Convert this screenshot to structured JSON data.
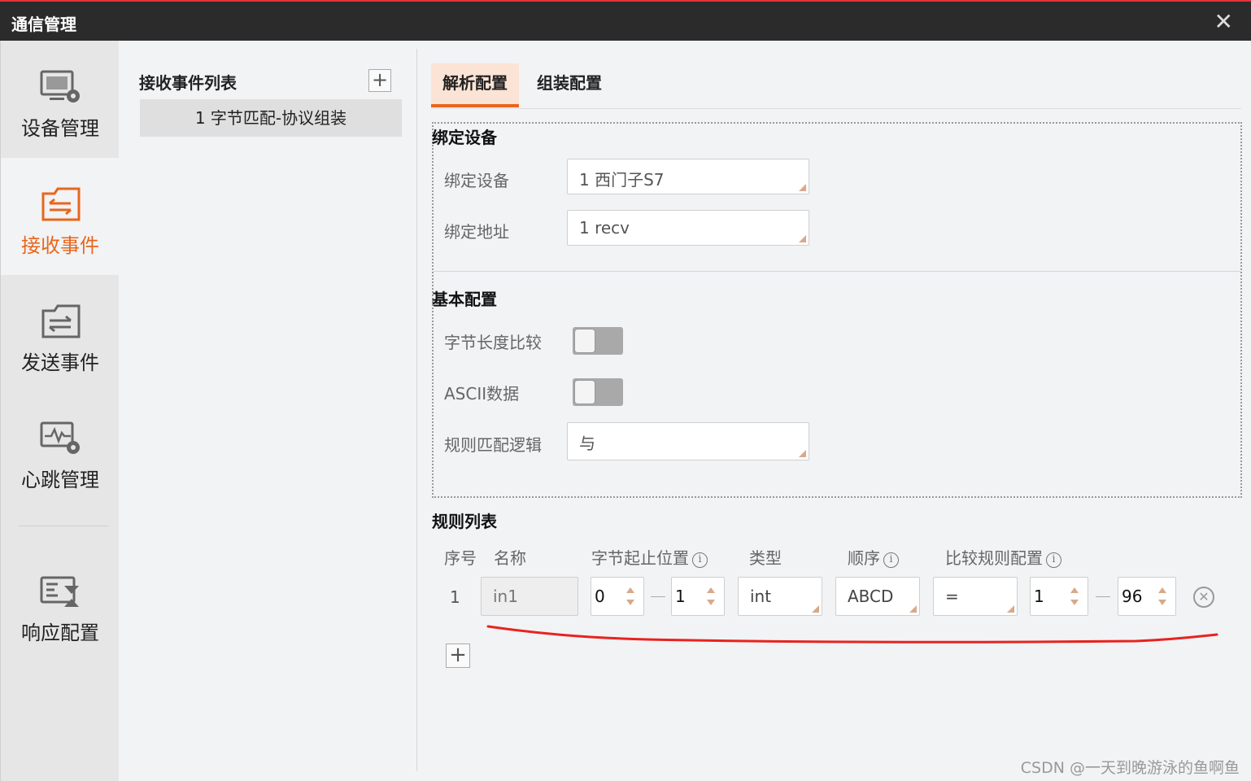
{
  "window": {
    "title": "通信管理",
    "close_glyph": "✕"
  },
  "nav": {
    "items": [
      {
        "label": "设备管理",
        "icon": "device-settings-icon"
      },
      {
        "label": "接收事件",
        "icon": "receive-event-icon",
        "active": true
      },
      {
        "label": "发送事件",
        "icon": "send-event-icon"
      },
      {
        "label": "心跳管理",
        "icon": "heartbeat-settings-icon"
      },
      {
        "label": "响应配置",
        "icon": "response-config-icon"
      }
    ],
    "accent_color": "#e8661c"
  },
  "events": {
    "title": "接收事件列表",
    "add_glyph": "+",
    "items": [
      {
        "label": "1 字节匹配-协议组装"
      }
    ]
  },
  "tabs": [
    {
      "label": "解析配置",
      "active": true
    },
    {
      "label": "组装配置"
    }
  ],
  "bind_section": {
    "title": "绑定设备",
    "device_label": "绑定设备",
    "device_value": "1 西门子S7",
    "address_label": "绑定地址",
    "address_value": "1 recv"
  },
  "basic_section": {
    "title": "基本配置",
    "byte_length_label": "字节长度比较",
    "byte_length_on": false,
    "ascii_label": "ASCII数据",
    "ascii_on": false,
    "logic_label": "规则匹配逻辑",
    "logic_value": "与"
  },
  "rules": {
    "title": "规则列表",
    "columns": {
      "index": "序号",
      "name": "名称",
      "byte_range": "字节起止位置",
      "type": "类型",
      "order": "顺序",
      "compare": "比较规则配置"
    },
    "info_glyph": "i",
    "rows": [
      {
        "index": "1",
        "name": "in1",
        "start": "0",
        "end": "1",
        "type": "int",
        "order": "ABCD",
        "operator": "=",
        "compare_from": "1",
        "compare_to": "96"
      }
    ],
    "remove_glyph": "✕",
    "add_glyph": "+"
  },
  "watermark": "CSDN @一天到晚游泳的鱼啊鱼",
  "annotation_color": "#e8231f"
}
